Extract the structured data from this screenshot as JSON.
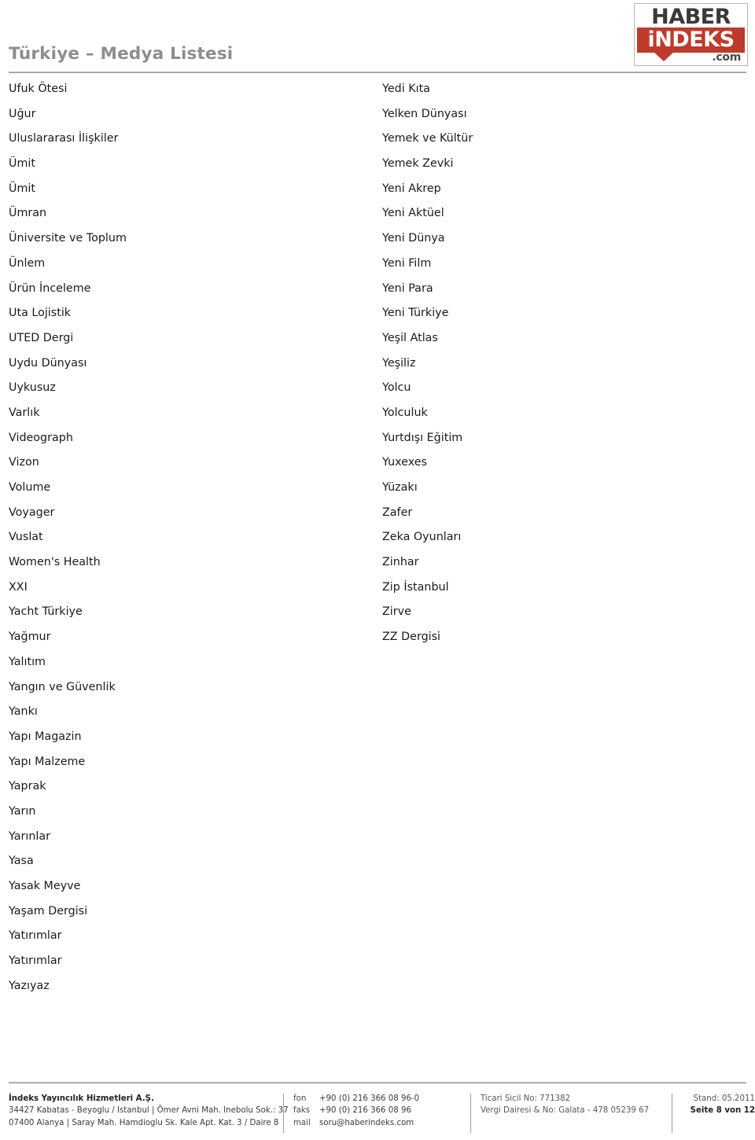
{
  "header": {
    "title": "Türkiye – Medya Listesi",
    "logo": {
      "top_text": "HABER",
      "bottom_text": "iNDEKS",
      "domain_text": ".com",
      "red": "#bf3a2b",
      "dark": "#3a3a3a"
    }
  },
  "columns": {
    "left": [
      "Ufuk Ötesi",
      "Uğur",
      "Uluslararası İlişkiler",
      "Ümit",
      "Ümit",
      "Ümran",
      "Üniversite ve Toplum",
      "Ünlem",
      "Ürün İnceleme",
      "Uta Lojistik",
      "UTED Dergi",
      "Uydu Dünyası",
      "Uykusuz",
      "Varlık",
      "Videograph",
      "Vizon",
      "Volume",
      "Voyager",
      "Vuslat",
      "Women's Health",
      "XXI",
      "Yacht Türkiye",
      "Yağmur",
      "Yalıtım",
      "Yangın ve Güvenlik",
      "Yankı",
      "Yapı Magazin",
      "Yapı Malzeme",
      "Yaprak",
      "Yarın",
      "Yarınlar",
      "Yasa",
      "Yasak Meyve",
      "Yaşam Dergisi",
      "Yatırımlar",
      "Yatırımlar",
      "Yazıyaz"
    ],
    "right": [
      "Yedi Kıta",
      "Yelken Dünyası",
      "Yemek ve Kültür",
      "Yemek Zevki",
      "Yeni Akrep",
      "Yeni Aktüel",
      "Yeni Dünya",
      "Yeni Film",
      "Yeni Para",
      "Yeni Türkiye",
      "Yeşil Atlas",
      "Yeşiliz",
      "Yolcu",
      "Yolculuk",
      "Yurtdışı Eğitim",
      "Yuxexes",
      "Yüzakı",
      "Zafer",
      "Zeka Oyunları",
      "Zinhar",
      "Zip İstanbul",
      "Zirve",
      "ZZ Dergisi"
    ]
  },
  "footer": {
    "company": {
      "name": "İndeks Yayıncılık Hizmetleri A.Ş.",
      "address_line_1": "34427 Kabatas - Beyoglu / Istanbul | Ömer Avni Mah. Inebolu Sok.: 37",
      "address_line_2": "07400 Alanya | Saray Mah. Hamdioglu Sk. Kale Apt. Kat. 3 / Daire 8"
    },
    "contact": {
      "phone_label": "fon",
      "phone_value": "+90 (0) 216 366 08 96-0",
      "fax_label": "faks",
      "fax_value": "+90 (0) 216 366 08 96",
      "mail_label": "mail",
      "mail_value": "soru@haberindeks.com"
    },
    "legal": {
      "trade_registry": "Ticari Sicil No: 771382",
      "tax_office": "Vergi Dairesi & No: Galata - 478 05239 67"
    },
    "stand": {
      "date": "Stand: 05.2011",
      "page": "Seite 8 von 12"
    }
  }
}
